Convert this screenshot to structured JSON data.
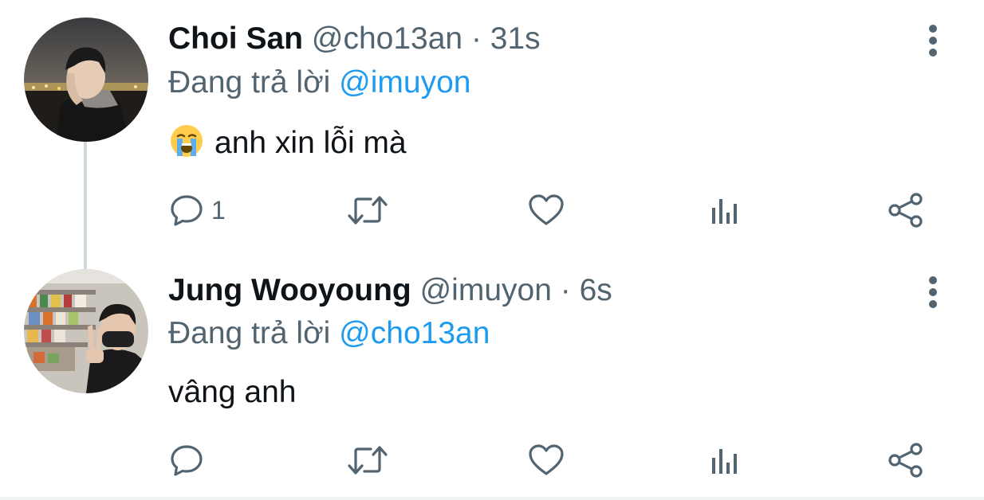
{
  "tweets": [
    {
      "display_name": "Choi San",
      "handle": "@cho13an",
      "separator": "·",
      "time": "31s",
      "reply_prefix": "Đang trả lời",
      "reply_to": "@imuyon",
      "emoji": "loudly-crying-face",
      "text": "anh xin lỗi mà",
      "reply_count": "1"
    },
    {
      "display_name": "Jung Wooyoung",
      "handle": "@imuyon",
      "separator": "·",
      "time": "6s",
      "reply_prefix": "Đang trả lời",
      "reply_to": "@cho13an",
      "text": "vâng anh",
      "reply_count": ""
    }
  ],
  "icons": {
    "reply": "speech-bubble-icon",
    "retweet": "retweet-icon",
    "like": "heart-icon",
    "views": "bar-chart-icon",
    "share": "share-icon",
    "more": "vertical-dots-icon"
  },
  "colors": {
    "text_primary": "#0f1419",
    "text_secondary": "#536471",
    "mention": "#1d9bf0",
    "thread_line": "#cfd9de"
  }
}
